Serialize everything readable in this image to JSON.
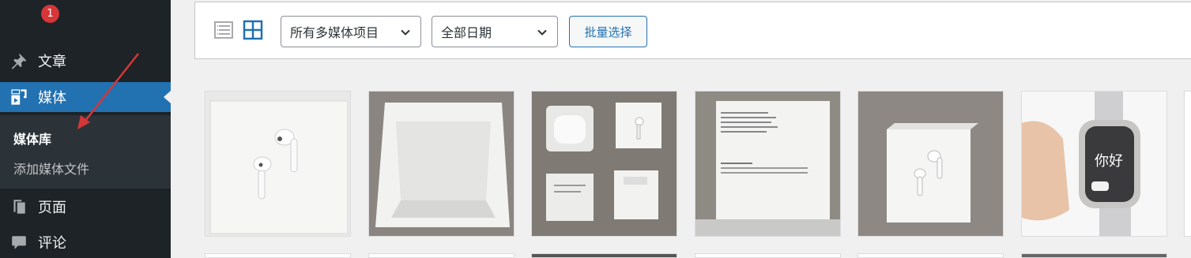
{
  "sidebar": {
    "update_badge": "1",
    "items": [
      {
        "label": "文章",
        "icon": "pushpin-icon"
      },
      {
        "label": "媒体",
        "icon": "media-icon"
      },
      {
        "label": "页面",
        "icon": "page-icon"
      },
      {
        "label": "评论",
        "icon": "comment-icon"
      }
    ],
    "submenu": [
      {
        "label": "媒体库"
      },
      {
        "label": "添加媒体文件"
      }
    ]
  },
  "toolbar": {
    "list_view_icon": "list-view-icon",
    "grid_view_icon": "grid-view-icon",
    "type_filter": "所有多媒体项目",
    "date_filter": "全部日期",
    "bulk_select": "批量选择"
  },
  "colors": {
    "sidebar_bg": "#1d2327",
    "accent": "#2271b1",
    "badge": "#d63638",
    "annotation_arrow": "#d63638"
  },
  "grid_items": [
    {
      "subject": "earbuds-box-front"
    },
    {
      "subject": "open-empty-box"
    },
    {
      "subject": "box-parts"
    },
    {
      "subject": "box-inner-text"
    },
    {
      "subject": "earbuds-box-angle"
    },
    {
      "subject": "watch-on-hand",
      "screen_text": "你好"
    }
  ]
}
